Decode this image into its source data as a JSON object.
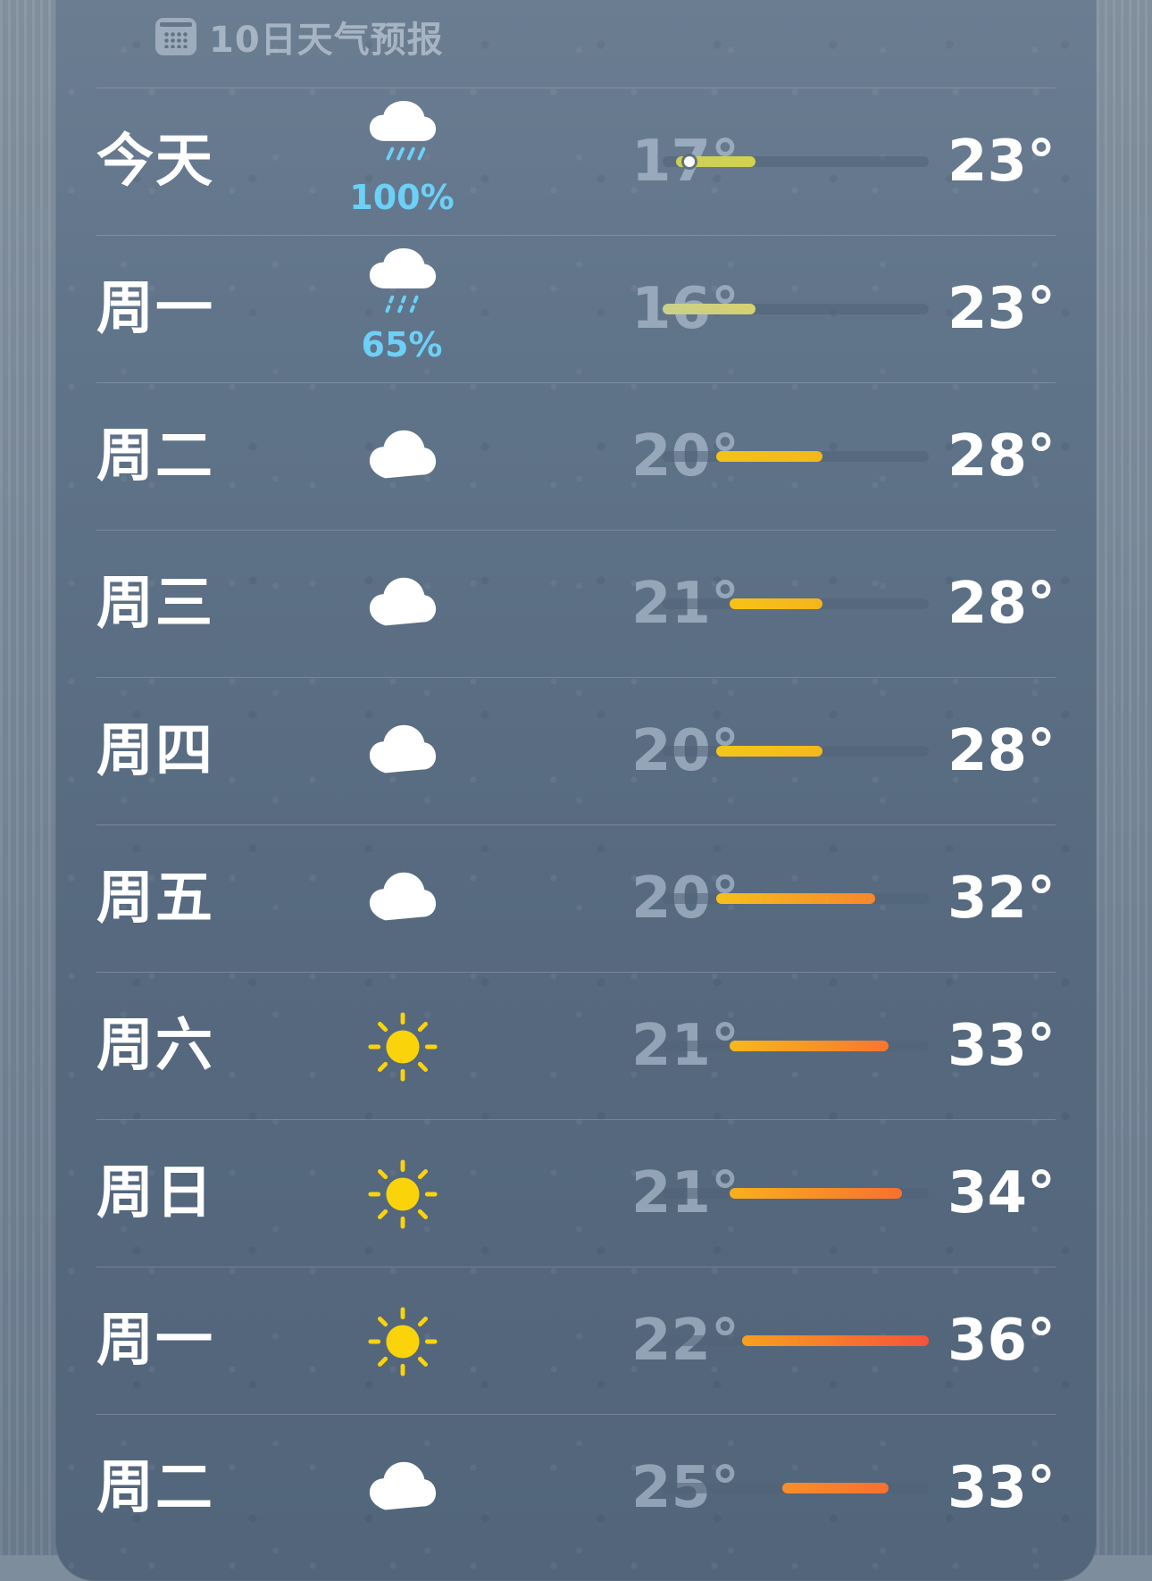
{
  "header": {
    "title": "10日天气预报",
    "icon": "calendar-icon"
  },
  "scale": {
    "min_temp": 16,
    "max_temp": 36
  },
  "days": [
    {
      "day": "今天",
      "icon": "cloud-rain-heavy-icon",
      "precip": "100%",
      "low": "17°",
      "high": "23°",
      "low_value": 17,
      "high_value": 23,
      "current_value": 18,
      "color_from": "#c9cf5a",
      "color_to": "#d2d24e"
    },
    {
      "day": "周一",
      "icon": "cloud-drizzle-icon",
      "precip": "65%",
      "low": "16°",
      "high": "23°",
      "low_value": 16,
      "high_value": 23,
      "color_from": "#c8d18a",
      "color_to": "#d6d070"
    },
    {
      "day": "周二",
      "icon": "cloud-icon",
      "precip": "",
      "low": "20°",
      "high": "28°",
      "low_value": 20,
      "high_value": 28,
      "color_from": "#f2c21a",
      "color_to": "#f5b71b"
    },
    {
      "day": "周三",
      "icon": "cloud-icon",
      "precip": "",
      "low": "21°",
      "high": "28°",
      "low_value": 21,
      "high_value": 28,
      "color_from": "#f6c318",
      "color_to": "#f6b41c"
    },
    {
      "day": "周四",
      "icon": "cloud-icon",
      "precip": "",
      "low": "20°",
      "high": "28°",
      "low_value": 20,
      "high_value": 28,
      "color_from": "#f2c71a",
      "color_to": "#f6b81b"
    },
    {
      "day": "周五",
      "icon": "cloud-icon",
      "precip": "",
      "low": "20°",
      "high": "32°",
      "low_value": 20,
      "high_value": 32,
      "color_from": "#f6c01c",
      "color_to": "#f7862c"
    },
    {
      "day": "周六",
      "icon": "sun-icon",
      "precip": "",
      "low": "21°",
      "high": "33°",
      "low_value": 21,
      "high_value": 33,
      "color_from": "#f8b81c",
      "color_to": "#f8752e"
    },
    {
      "day": "周日",
      "icon": "sun-icon",
      "precip": "",
      "low": "21°",
      "high": "34°",
      "low_value": 21,
      "high_value": 34,
      "color_from": "#f8b01d",
      "color_to": "#f8702f"
    },
    {
      "day": "周一",
      "icon": "sun-icon",
      "precip": "",
      "low": "22°",
      "high": "36°",
      "low_value": 22,
      "high_value": 36,
      "color_from": "#f8a01f",
      "color_to": "#f6533a"
    },
    {
      "day": "周二",
      "icon": "cloud-icon",
      "precip": "",
      "low": "25°",
      "high": "33°",
      "low_value": 25,
      "high_value": 33,
      "color_from": "#f88f28",
      "color_to": "#f6702f"
    }
  ]
}
